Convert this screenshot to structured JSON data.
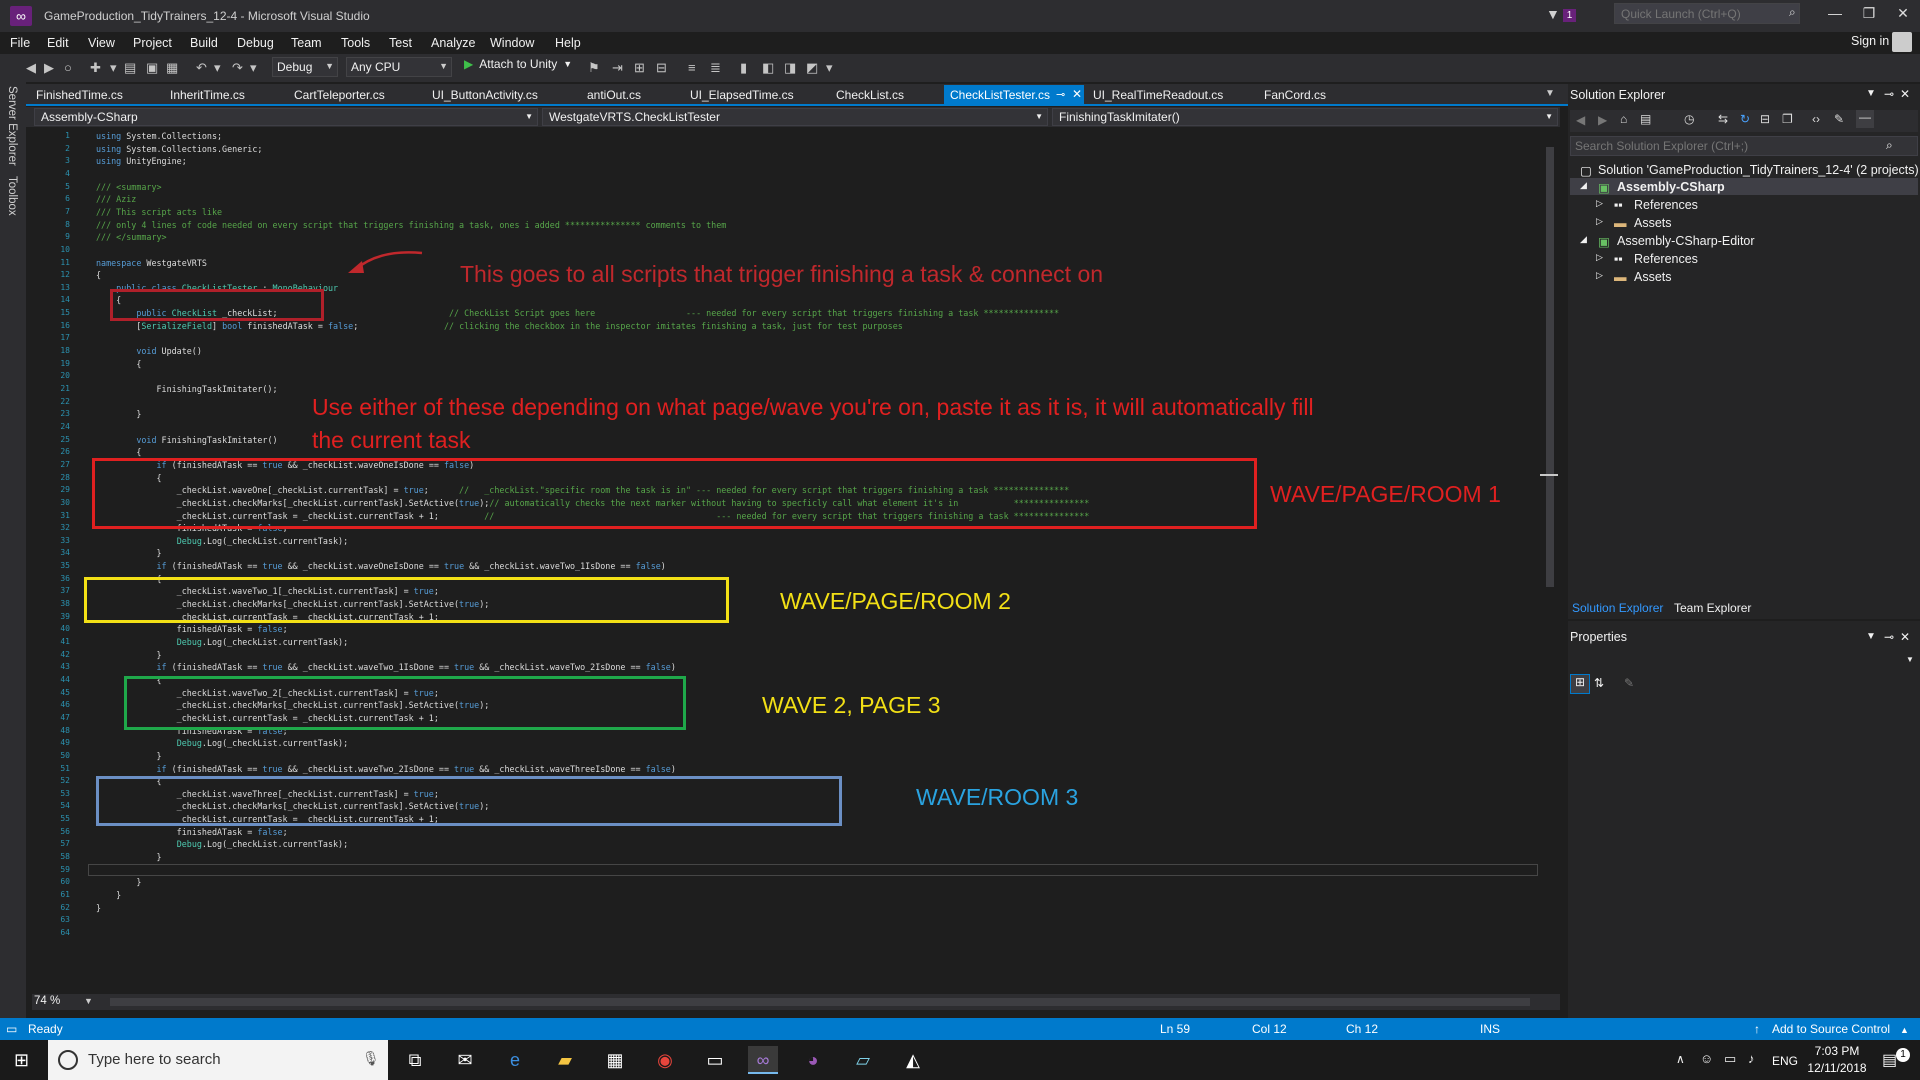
{
  "window": {
    "title": "GameProduction_TidyTrainers_12-4 - Microsoft Visual Studio",
    "notif_count": "1",
    "quick_launch_placeholder": "Quick Launch (Ctrl+Q)"
  },
  "menu": [
    "File",
    "Edit",
    "View",
    "Project",
    "Build",
    "Debug",
    "Team",
    "Tools",
    "Test",
    "Analyze",
    "Window",
    "Help"
  ],
  "sign_in": "Sign in",
  "toolbar": {
    "config": "Debug",
    "platform": "Any CPU",
    "attach": "Attach to Unity"
  },
  "side_tabs": {
    "server_explorer": "Server Explorer",
    "toolbox": "Toolbox"
  },
  "tabs": [
    "FinishedTime.cs",
    "InheritTime.cs",
    "CartTeleporter.cs",
    "UI_ButtonActivity.cs",
    "antiOut.cs",
    "UI_ElapsedTime.cs",
    "CheckList.cs",
    "CheckListTester.cs",
    "UI_RealTimeReadout.cs",
    "FanCord.cs"
  ],
  "active_tab": "CheckListTester.cs",
  "nav": {
    "project": "Assembly-CSharp",
    "class": "WestgateVRTS.CheckListTester",
    "member": "FinishingTaskImitater()"
  },
  "code_lines": [
    "using System.Collections;",
    "using System.Collections.Generic;",
    "using UnityEngine;",
    "",
    "/// <summary>",
    "/// Aziz",
    "/// This script acts like",
    "/// only 4 lines of code needed on every script that triggers finishing a task, ones i added *************** comments to them",
    "/// </summary>",
    "",
    "namespace WestgateVRTS",
    "{",
    "    public class CheckListTester : MonoBehaviour",
    "    {",
    "        public CheckList _checkList;                                  // CheckList Script goes here                  --- needed for every script that triggers finishing a task ***************",
    "        [SerializeField] bool finishedATask = false;                 // clicking the checkbox in the inspector imitates finishing a task, just for test purposes",
    "",
    "        void Update()",
    "        {",
    "",
    "            FinishingTaskImitater();",
    "",
    "        }",
    "",
    "        void FinishingTaskImitater()",
    "        {",
    "            if (finishedATask == true && _checkList.waveOneIsDone == false)",
    "            {",
    "                _checkList.waveOne[_checkList.currentTask] = true;      //   _checkList.\"specific room the task is in\" --- needed for every script that triggers finishing a task ***************",
    "                _checkList.checkMarks[_checkList.currentTask].SetActive(true);// automatically checks the next marker without having to specficly call what element it's in           ***************",
    "                _checkList.currentTask = _checkList.currentTask + 1;         //                                            --- needed for every script that triggers finishing a task ***************",
    "                finishedATask = false;",
    "                Debug.Log(_checkList.currentTask);",
    "            }",
    "            if (finishedATask == true && _checkList.waveOneIsDone == true && _checkList.waveTwo_1IsDone == false)",
    "            {",
    "                _checkList.waveTwo_1[_checkList.currentTask] = true;",
    "                _checkList.checkMarks[_checkList.currentTask].SetActive(true);",
    "                _checkList.currentTask = _checkList.currentTask + 1;",
    "                finishedATask = false;",
    "                Debug.Log(_checkList.currentTask);",
    "            }",
    "            if (finishedATask == true && _checkList.waveTwo_1IsDone == true && _checkList.waveTwo_2IsDone == false)",
    "            {",
    "                _checkList.waveTwo_2[_checkList.currentTask] = true;",
    "                _checkList.checkMarks[_checkList.currentTask].SetActive(true);",
    "                _checkList.currentTask = _checkList.currentTask + 1;",
    "                finishedATask = false;",
    "                Debug.Log(_checkList.currentTask);",
    "            }",
    "            if (finishedATask == true && _checkList.waveTwo_2IsDone == true && _checkList.waveThreeIsDone == false)",
    "            {",
    "                _checkList.waveThree[_checkList.currentTask] = true;",
    "                _checkList.checkMarks[_checkList.currentTask].SetActive(true);",
    "                _checkList.currentTask = _checkList.currentTask + 1;",
    "                finishedATask = false;",
    "                Debug.Log(_checkList.currentTask);",
    "            }",
    "",
    "        }",
    "    }",
    "}",
    "",
    ""
  ],
  "annotations": {
    "top_note": "This goes to all scripts that trigger finishing a task & connect on",
    "middle_note_1": "Use either of these depending on what page/wave you're on, paste it as it is, it will automatically fill",
    "middle_note_2": "the current task",
    "label_1": "WAVE/PAGE/ROOM 1",
    "label_2": "WAVE/PAGE/ROOM 2",
    "label_3": "WAVE 2, PAGE 3",
    "label_4": "WAVE/ROOM 3"
  },
  "zoom": "74 %",
  "solution_explorer": {
    "title": "Solution Explorer",
    "search_placeholder": "Search Solution Explorer (Ctrl+;)",
    "solution": "Solution 'GameProduction_TidyTrainers_12-4' (2 projects)",
    "project1": "Assembly-CSharp",
    "references": "References",
    "assets": "Assets",
    "project2": "Assembly-CSharp-Editor",
    "tab_se": "Solution Explorer",
    "tab_te": "Team Explorer"
  },
  "properties": {
    "title": "Properties"
  },
  "status": {
    "ready": "Ready",
    "ln": "Ln 59",
    "col": "Col 12",
    "ch": "Ch 12",
    "ins": "INS",
    "source_control": "Add to Source Control"
  },
  "taskbar": {
    "search": "Type here to search",
    "lang": "ENG",
    "time": "7:03 PM",
    "date": "12/11/2018"
  },
  "colors": {
    "accent": "#007acc",
    "annotation_red": "#e02020",
    "annotation_yellow": "#f2e016",
    "annotation_green": "#1fa84a",
    "annotation_blue": "#6b8fc4",
    "label_blue": "#2aa3e0"
  }
}
